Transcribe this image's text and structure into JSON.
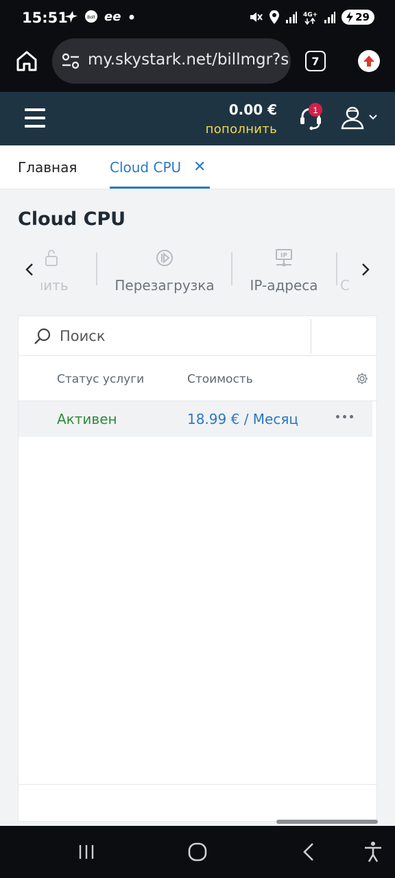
{
  "status_bar": {
    "time": "15:51",
    "battery": "29",
    "network": "4G+"
  },
  "browser": {
    "url": "my.skystark.net/billmgr?s",
    "tab_count": "7"
  },
  "header": {
    "balance": "0.00 €",
    "topup_label": "пополнить",
    "support_badge": "1"
  },
  "tabs": {
    "home_label": "Главная",
    "active_label": "Cloud CPU",
    "close_symbol": "✕"
  },
  "page_title": "Cloud CPU",
  "toolbar": {
    "items": [
      {
        "label": "...лить",
        "icon": "unlock-icon"
      },
      {
        "label": "Перезагрузка",
        "icon": "restart-icon"
      },
      {
        "label": "IP-адреса",
        "icon": "ip-icon"
      },
      {
        "label": "С...",
        "icon": "more-icon"
      }
    ],
    "partial_left_label": "лить",
    "reboot_label": "Перезагрузка",
    "ip_label": "IP-адреса",
    "partial_right_label": "С"
  },
  "search": {
    "placeholder": "Поиск"
  },
  "table": {
    "columns": [
      "Статус услуги",
      "Стоимость"
    ],
    "rows": [
      {
        "status": "Активен",
        "cost": "18.99 € / Месяц"
      }
    ]
  }
}
